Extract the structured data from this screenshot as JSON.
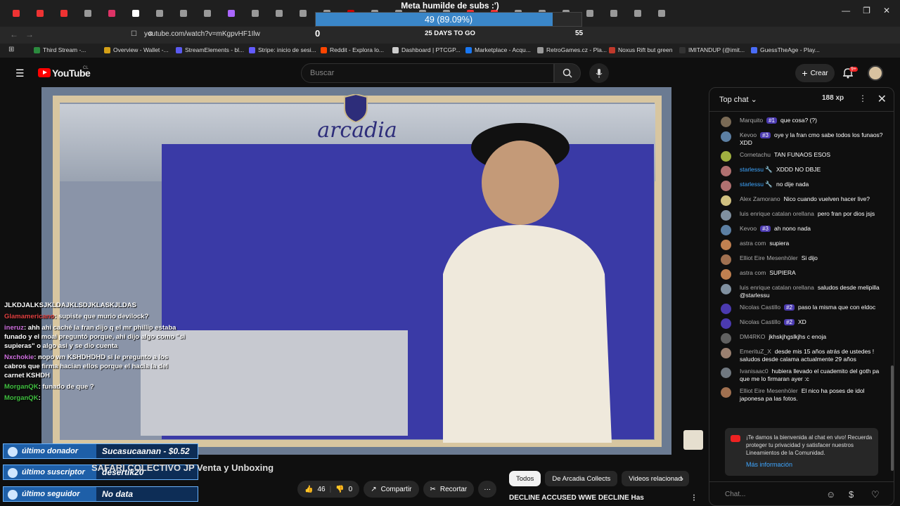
{
  "browser": {
    "url": "youtube.com/watch?v=mKgpvHF1Ilw",
    "bookmarks": [
      {
        "label": "Third Stream -...",
        "color": "#2b8a3e"
      },
      {
        "label": "Overview - Wallet -...",
        "color": "#d4a017"
      },
      {
        "label": "StreamElements - bl...",
        "color": "#5a5af0"
      },
      {
        "label": "Stripe: inicio de sesi...",
        "color": "#635bff"
      },
      {
        "label": "Reddit - Explora lo...",
        "color": "#ff4500"
      },
      {
        "label": "Dashboard | PTCGP...",
        "color": "#cccccc"
      },
      {
        "label": "Marketplace - Acqu...",
        "color": "#1877f2"
      },
      {
        "label": "RetroGames.cz - Pla...",
        "color": "#999999"
      },
      {
        "label": "Noxus Rift but green",
        "color": "#c0392b"
      },
      {
        "label": "IMITANDUP (@imit...",
        "color": "#333333"
      },
      {
        "label": "GuessTheAge - Play...",
        "color": "#4a6cf7"
      }
    ],
    "window_controls": [
      "—",
      "❐",
      "✕"
    ]
  },
  "goal": {
    "title": "Meta humilde de subs :')",
    "progress_text": "49 (89.09%)",
    "progress_fraction": 0.8909,
    "start": "0",
    "days_left": "25 DAYS TO GO",
    "target": "55",
    "fill_color": "#3a86c8"
  },
  "yt": {
    "logo_text": "YouTube",
    "country": "CL",
    "search_placeholder": "Buscar",
    "create_label": "Crear",
    "notif_count": "9+"
  },
  "video": {
    "logo_text": "arcadia",
    "title": "SAFARI COLECTIVO JP Venta y Unboxing",
    "likes": "46",
    "dislikes": "0",
    "share_label": "Compartir",
    "clip_label": "Recortar",
    "more_label": "···"
  },
  "overlay_chat": [
    {
      "name": "",
      "name_color": "#ffffff",
      "text": "JLKDJALKSJKLDAJKLSDJKLASKJLDAS"
    },
    {
      "name": "Glamamericano",
      "name_color": "#e04040",
      "text": ": supiste que murio devilock?"
    },
    {
      "name": "ineruz",
      "name_color": "#d070e0",
      "text": ": ahh ahi caché la fran dijo q el mr phillip estaba funado y el moai preguntó porque, ahi dijo algo como \"si supieras\" o algo asi y se dio cuenta"
    },
    {
      "name": "Nxchokie",
      "name_color": "#d070e0",
      "text": ": nopo wn KSHDHDHD si le pregunto a los cabros que firma hacian ellos porque el hacia la del carnet KSHDH"
    },
    {
      "name": "MorganQK",
      "name_color": "#40c040",
      "text": ": funado de que ?"
    },
    {
      "name": "MorganQK",
      "name_color": "#40c040",
      "text": ":"
    }
  ],
  "stream_labels": [
    {
      "key": "último donador",
      "value": "Sucasucaanan - $0.52"
    },
    {
      "key": "último suscriptor",
      "value": "desertik20"
    },
    {
      "key": "último seguidor",
      "value": "No data"
    }
  ],
  "related": {
    "tabs": [
      "Todos",
      "De Arcadia Collects",
      "Videos relacionad"
    ],
    "next_label": "›",
    "item_text": "DECLINE ACCUSED  WWE DECLINE Has",
    "more_label": "⋮"
  },
  "chat": {
    "header": "Top chat",
    "header_caret": "⌄",
    "xp": "188 xp",
    "messages": [
      {
        "author": "Marquito",
        "badge": "#1",
        "text": "que cosa? (?)",
        "avatar": "#7a6a55"
      },
      {
        "author": "Kevoo",
        "badge": "#3",
        "text": "oye y la fran cmo sabe todos los funaos? XDD",
        "avatar": "#5c7fa3"
      },
      {
        "author": "Cornetachu",
        "badge": "",
        "text": "TAN FUNAOS ESOS",
        "avatar": "#a0b040"
      },
      {
        "author": "starlessu 🔧",
        "badge": "",
        "text": "XDDD NO DBJE",
        "avatar": "#b07070",
        "author_color": "#3ea6ff"
      },
      {
        "author": "starlessu 🔧",
        "badge": "",
        "text": "no dije nada",
        "avatar": "#b07070",
        "author_color": "#3ea6ff"
      },
      {
        "author": "Alex Zamorano",
        "badge": "",
        "text": "Nico cuando vuelven hacer live?",
        "avatar": "#d0c080"
      },
      {
        "author": "luis enrique catalan orellana",
        "badge": "",
        "text": "pero fran por dios jsjs",
        "avatar": "#8090a0"
      },
      {
        "author": "Kevoo",
        "badge": "#3",
        "text": "ah nono nada",
        "avatar": "#5c7fa3"
      },
      {
        "author": "astra com",
        "badge": "",
        "text": "supiera",
        "avatar": "#c08050"
      },
      {
        "author": "Elliot Eire Mesenhöler",
        "badge": "",
        "text": "Si dijo",
        "avatar": "#a07050"
      },
      {
        "author": "astra com",
        "badge": "",
        "text": "SUPIERA",
        "avatar": "#c08050"
      },
      {
        "author": "luis enrique catalan orellana",
        "badge": "",
        "text": "saludos desde melipilla @starlessu",
        "avatar": "#8090a0"
      },
      {
        "author": "Nicolas Castillo",
        "badge": "#2",
        "text": "paso la misma que con eldoc",
        "avatar": "#4b3ab0"
      },
      {
        "author": "Nicolas Castillo",
        "badge": "#2",
        "text": "XD",
        "avatar": "#4b3ab0"
      },
      {
        "author": "DM4RKO",
        "badge": "",
        "text": "jkhskjhgslkjhs c enoja",
        "avatar": "#606060"
      },
      {
        "author": "EmerituZ_X",
        "badge": "",
        "text": "desde mis 15 años atrás de ustedes ! saludos desde calama actualmente 29 años",
        "avatar": "#9a8070"
      },
      {
        "author": "Ivanisaac0",
        "badge": "",
        "text": "hubiera llevado el cuademito del goth pa que me lo firmaran ayer :c",
        "avatar": "#707880"
      },
      {
        "author": "Elliot Eire Mesenhöler",
        "badge": "",
        "text": "El nico ha poses de idol japonesa pa las fotos.",
        "avatar": "#a07050"
      }
    ],
    "welcome_text": "¡Te damos la bienvenida al chat en vivo! Recuerda proteger tu privacidad y satisfacer nuestros Lineamientos de la Comunidad.",
    "welcome_link": "Más información",
    "input_placeholder": "Chat...",
    "close_icon": "✕",
    "more_icon": "⋮"
  }
}
